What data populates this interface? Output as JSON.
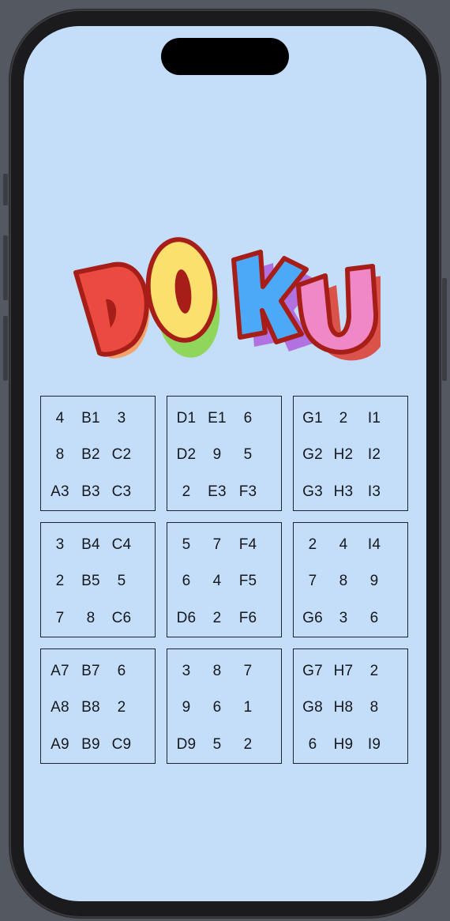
{
  "logo": {
    "text": "DOKU",
    "colors": {
      "d": "#ea4a3f",
      "o": "#fbe06e",
      "k": "#4ba9f7",
      "u": "#f088c7",
      "outline": "#a61e17"
    }
  },
  "board": {
    "boxes": [
      [
        "4",
        "B1",
        "3",
        "8",
        "B2",
        "C2",
        "A3",
        "B3",
        "C3"
      ],
      [
        "D1",
        "E1",
        "6",
        "D2",
        "9",
        "5",
        "2",
        "E3",
        "F3"
      ],
      [
        "G1",
        "2",
        "I1",
        "G2",
        "H2",
        "I2",
        "G3",
        "H3",
        "I3"
      ],
      [
        "3",
        "B4",
        "C4",
        "2",
        "B5",
        "5",
        "7",
        "8",
        "C6"
      ],
      [
        "5",
        "7",
        "F4",
        "6",
        "4",
        "F5",
        "D6",
        "2",
        "F6"
      ],
      [
        "2",
        "4",
        "I4",
        "7",
        "8",
        "9",
        "G6",
        "3",
        "6"
      ],
      [
        "A7",
        "B7",
        "6",
        "A8",
        "B8",
        "2",
        "A9",
        "B9",
        "C9"
      ],
      [
        "3",
        "8",
        "7",
        "9",
        "6",
        "1",
        "D9",
        "5",
        "2"
      ],
      [
        "G7",
        "H7",
        "2",
        "G8",
        "H8",
        "8",
        "6",
        "H9",
        "I9"
      ]
    ]
  }
}
